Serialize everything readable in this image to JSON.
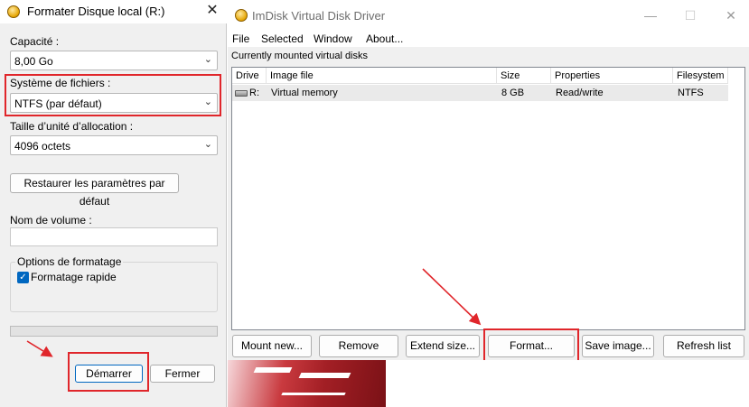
{
  "format_dialog": {
    "title": "Formater Disque local (R:)",
    "close_glyph": "✕",
    "capacity_label": "Capacité :",
    "capacity_value": "8,00 Go",
    "filesystem_label": "Système de fichiers :",
    "filesystem_value": "NTFS (par défaut)",
    "alloc_label": "Taille d’unité d’allocation :",
    "alloc_value": "4096 octets",
    "restore_button": "Restaurer les paramètres par défaut",
    "volume_label": "Nom de volume :",
    "volume_value": "",
    "options_group": "Options de formatage",
    "quick_format_label": "Formatage rapide",
    "quick_format_checked": true,
    "progress_fraction": 0,
    "start_button": "Démarrer",
    "close_button": "Fermer"
  },
  "imdisk": {
    "title": "ImDisk Virtual Disk Driver",
    "menu": [
      "File",
      "Selected",
      "Window",
      "About..."
    ],
    "list_caption": "Currently mounted virtual disks",
    "columns": [
      "Drive",
      "Image file",
      "Size",
      "Properties",
      "Filesystem"
    ],
    "rows": [
      {
        "drive": "R:",
        "image": "Virtual memory",
        "size": "8 GB",
        "properties": "Read/write",
        "filesystem": "NTFS"
      }
    ],
    "buttons": {
      "mount": "Mount new...",
      "remove": "Remove",
      "extend": "Extend size...",
      "format": "Format...",
      "save": "Save image...",
      "refresh": "Refresh list"
    },
    "window_controls": {
      "minimize": "—",
      "maximize": "☐",
      "close": "✕"
    }
  },
  "colors": {
    "highlight_box": "#e0262b",
    "checkbox_accent": "#0067c0"
  }
}
